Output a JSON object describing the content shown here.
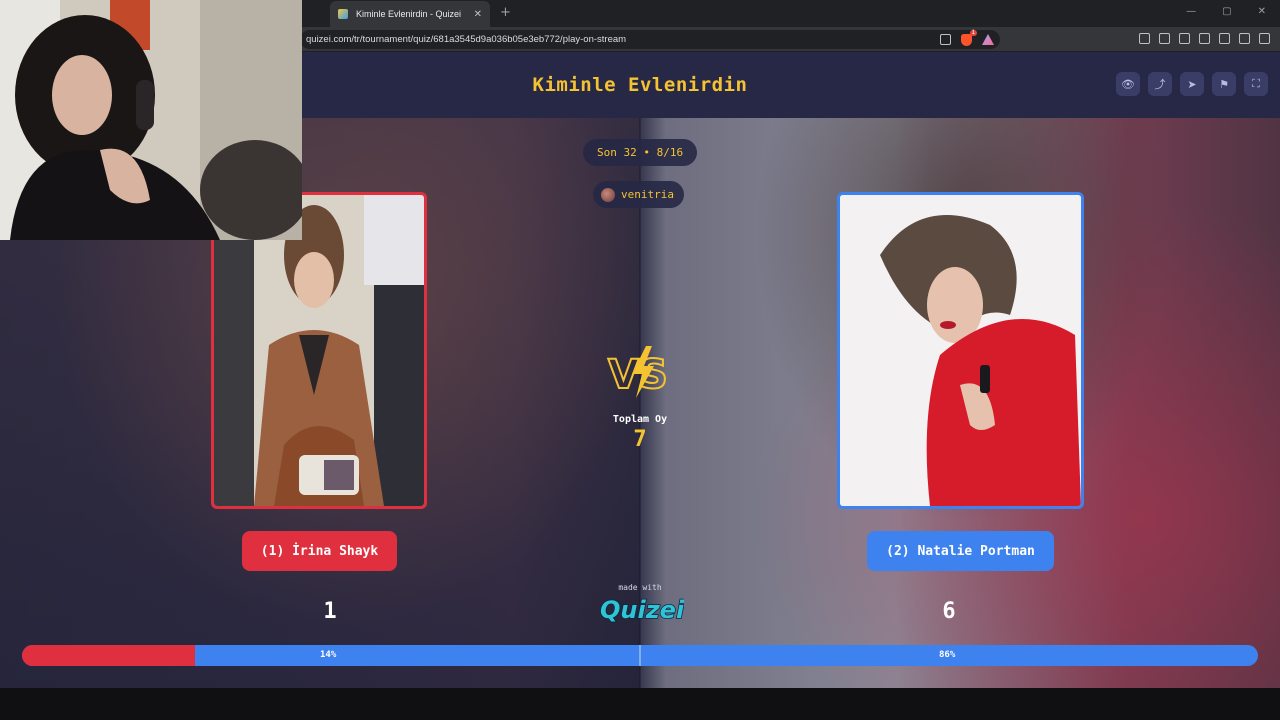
{
  "browser": {
    "tab_title": "Kiminle Evlenirdin - Quizei",
    "tab_close": "✕",
    "new_tab": "+",
    "window_controls": [
      "—",
      "▢",
      "✕"
    ],
    "url": "quizei.com/tr/tournament/quiz/681a3545d9a036b05e3eb772/play-on-stream",
    "shields_count": "1",
    "rewards_count": "1"
  },
  "header": {
    "title": "Kiminle Evlenirdin",
    "actions": [
      "eye-icon",
      "share-icon",
      "send-icon",
      "flag-icon",
      "fullscreen-icon"
    ],
    "action_glyphs": [
      "👁",
      "⤴",
      "➤",
      "⚑",
      "⛶"
    ]
  },
  "round": {
    "label": "Son 32 • 8/16",
    "username": "venitria"
  },
  "total": {
    "label": "Toplam Oy",
    "value": "7"
  },
  "contestants": [
    {
      "name": "(1) İrina Shayk",
      "votes": "1",
      "percent": "14%",
      "fraction": 0.14,
      "color": "#e0303f"
    },
    {
      "name": "(2) Natalie Portman",
      "votes": "6",
      "percent": "86%",
      "fraction": 0.86,
      "color": "#3e82f0"
    }
  ],
  "branding": {
    "made_with": "made with",
    "logo_text": "Quizei"
  },
  "colors": {
    "accent_yellow": "#f5c331",
    "red": "#e0303f",
    "blue": "#3e82f0",
    "header_bg": "#262845"
  }
}
